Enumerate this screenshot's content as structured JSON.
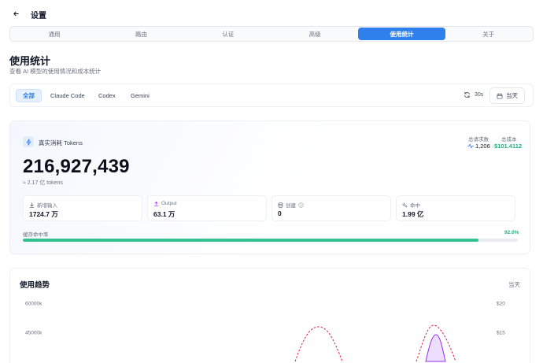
{
  "header": {
    "title": "设置"
  },
  "tabs": [
    {
      "label": "通用"
    },
    {
      "label": "路由"
    },
    {
      "label": "认证"
    },
    {
      "label": "高级"
    },
    {
      "label": "使用统计",
      "active": true
    },
    {
      "label": "关于"
    }
  ],
  "section": {
    "title": "使用统计",
    "subtitle": "查看 AI 模型的使用情况和成本统计"
  },
  "filters": {
    "providers": [
      "全部",
      "Claude Code",
      "Codex",
      "Gemini"
    ],
    "selected": "全部",
    "refresh_interval": "30s",
    "range_label": "当天"
  },
  "summary": {
    "label": "真实消耗 Tokens",
    "total_tokens": "216,927,439",
    "approx": "≈ 2.17 亿 tokens",
    "requests_label": "总请求数",
    "requests_value": "1,206",
    "cost_label": "总成本",
    "cost_value": "$101.4112",
    "stats": [
      {
        "label": "新增输入",
        "value": "1724.7 万",
        "icon": "download-icon"
      },
      {
        "label": "Output",
        "value": "63.1 万",
        "icon": "upload-icon"
      },
      {
        "label": "创建",
        "value": "0",
        "icon": "database-icon"
      },
      {
        "label": "命中",
        "value": "1.99 亿",
        "icon": "sparkle-icon"
      }
    ],
    "cache_hit_label": "缓存命中率",
    "cache_hit_rate_text": "92.0%",
    "cache_hit_rate": 0.92
  },
  "trend": {
    "title": "使用趋势",
    "range_label": "当天"
  },
  "colors": {
    "accent": "#2f80ed",
    "success": "#10b981",
    "progress": "#34c18f",
    "series_red": "#e11d48",
    "series_purple": "#9333ea"
  },
  "chart_data": {
    "type": "area",
    "title": "使用趋势",
    "y_left_ticks": [
      "60000k",
      "45000k"
    ],
    "y_right_ticks": [
      "$20",
      "$15"
    ],
    "y_left_range": [
      45000,
      60000
    ],
    "y_right_range": [
      15,
      20
    ],
    "series": []
  }
}
